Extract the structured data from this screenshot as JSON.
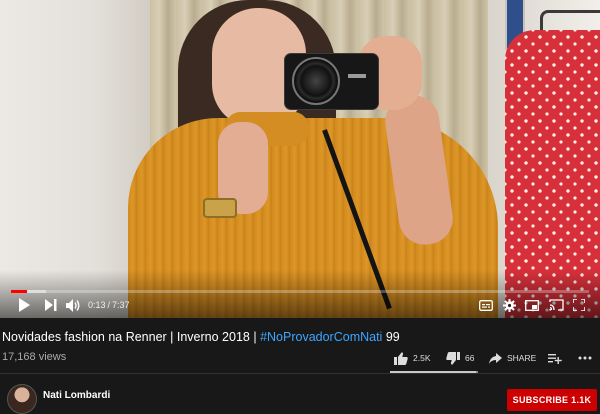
{
  "player": {
    "current_time": "0:13",
    "separator": "/",
    "duration": "7:37",
    "progress_played": 0.028,
    "progress_loaded": 0.06,
    "accent_color": "#ff0000"
  },
  "controls": {
    "left_icons": [
      "play-icon",
      "next-icon",
      "volume-icon"
    ],
    "right_icons": [
      "subtitles-icon",
      "settings-icon",
      "miniplayer-icon",
      "theater-icon",
      "cast-icon",
      "fullscreen-icon"
    ]
  },
  "video": {
    "title": "Novidades fashion na Renner | Inverno 2018 | ",
    "hashtag": "#NoProvadorComNati",
    "title_suffix": " 99",
    "views": "17,168 views",
    "hashtag_color": "#3ea6ff"
  },
  "actions": {
    "likes": "2.5K",
    "dislikes": "66",
    "share_label": "SHARE",
    "like_ratio": 0.974,
    "icons": [
      "thumbs-up-icon",
      "thumbs-down-icon",
      "share-icon",
      "add-to-playlist-icon",
      "more-icon"
    ]
  },
  "channel": {
    "name": "Nati Lombardi",
    "subscribe_label": "SUBSCRIBE 1.1K",
    "subscribe_color": "#cc0000"
  }
}
